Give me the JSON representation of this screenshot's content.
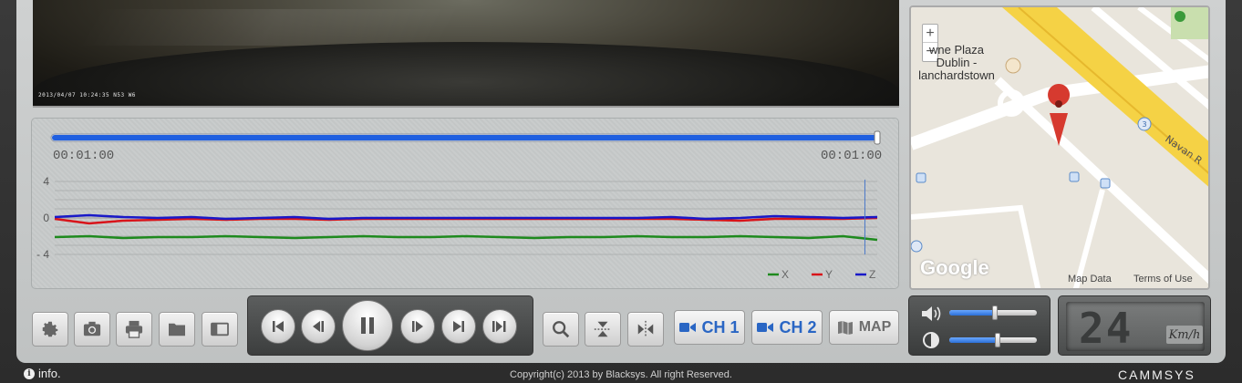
{
  "playback": {
    "time_start": "00:01:00",
    "time_end": "00:01:00",
    "progress": 1.0
  },
  "video": {
    "stamp": "2013/04/07 10:24:35 N53 W6"
  },
  "chart_data": {
    "type": "line",
    "ylim": [
      -4,
      4
    ],
    "yticks": [
      "4",
      "0",
      "- 4"
    ],
    "legend_position": "bottom-right",
    "series": [
      {
        "name": "X",
        "color": "#1e8a1e",
        "values": [
          -2.1,
          -2.0,
          -2.2,
          -2.1,
          -2.1,
          -2.0,
          -2.1,
          -2.2,
          -2.1,
          -2.0,
          -2.1,
          -2.1,
          -2.0,
          -2.1,
          -2.2,
          -2.1,
          -2.1,
          -2.0,
          -2.1,
          -2.1,
          -2.0,
          -2.1,
          -2.2,
          -2.0,
          -2.4
        ]
      },
      {
        "name": "Y",
        "color": "#d8141a",
        "values": [
          -0.1,
          -0.6,
          -0.3,
          -0.2,
          -0.1,
          -0.2,
          -0.1,
          -0.1,
          -0.2,
          -0.1,
          -0.1,
          -0.1,
          -0.1,
          -0.1,
          -0.1,
          -0.1,
          -0.1,
          -0.1,
          -0.1,
          -0.2,
          -0.3,
          -0.1,
          -0.1,
          -0.1,
          0.0
        ]
      },
      {
        "name": "Z",
        "color": "#1919c8",
        "values": [
          0.1,
          0.3,
          0.1,
          0.0,
          0.1,
          -0.1,
          0.0,
          0.1,
          -0.1,
          0.0,
          0.0,
          0.0,
          0.0,
          0.0,
          0.0,
          0.0,
          0.0,
          0.0,
          0.1,
          -0.1,
          0.0,
          0.2,
          0.1,
          0.0,
          0.1
        ]
      }
    ],
    "cursor_fraction": 0.985
  },
  "toolbar": {
    "buttons": [
      {
        "name": "settings-button",
        "icon": "gear-icon"
      },
      {
        "name": "snapshot-button",
        "icon": "camera-icon"
      },
      {
        "name": "print-button",
        "icon": "printer-icon"
      },
      {
        "name": "open-folder-button",
        "icon": "folder-icon"
      },
      {
        "name": "window-button",
        "icon": "window-icon"
      }
    ]
  },
  "player": {
    "buttons": [
      "skip-start",
      "step-back",
      "pause",
      "step-forward",
      "skip-end",
      "play-next"
    ]
  },
  "view": {
    "ch1_label": "CH 1",
    "ch2_label": "CH 2",
    "map_label": "MAP"
  },
  "map": {
    "zoom_in": "+",
    "zoom_out": "−",
    "label_place": "wne Plaza\nDublin -\nlanchardstown",
    "label_road": "Navan R",
    "label_route": "3",
    "google": "Google",
    "map_data": "Map Data",
    "terms": "Terms of Use"
  },
  "audio": {
    "volume": 0.52,
    "brightness": 0.55
  },
  "speed": {
    "value": "24",
    "unit": "Km/h"
  },
  "footer": {
    "info": "info.",
    "copyright": "Copyright(c) 2013 by Blacksys. All right Reserved.",
    "brand": "CAMMSYS"
  },
  "colors": {
    "accent": "#2a66c4",
    "progress": "#1f5fe0"
  }
}
